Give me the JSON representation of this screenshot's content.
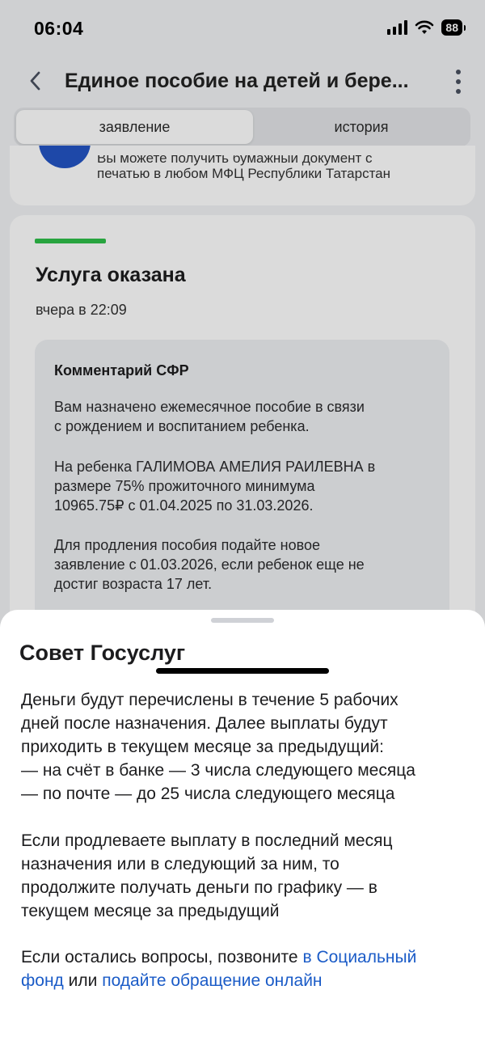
{
  "status_bar": {
    "time": "06:04",
    "battery": "88",
    "icons": [
      "signal-icon",
      "wifi-icon",
      "battery-icon"
    ]
  },
  "header": {
    "title": "Единое пособие на детей и бере...",
    "back_icon": "chevron-left-icon",
    "menu_icon": "more-vertical-icon"
  },
  "tabs": [
    {
      "label": "заявление",
      "active": true
    },
    {
      "label": "история",
      "active": false
    }
  ],
  "top_card": {
    "line1": "Вы можете получить бумажный документ с",
    "line2": "печатью в любом МФЦ Республики Татарстан"
  },
  "status_card": {
    "title": "Услуга оказана",
    "time": "вчера в 22:09",
    "progress": 1.0,
    "progress_color": "#2fbf4a",
    "comment": {
      "title": "Комментарий СФР",
      "p1": [
        "Вам назначено ежемесячное пособие в связи",
        "с рождением и воспитанием ребенка."
      ],
      "p2": [
        "На ребенка ГАЛИМОВА АМЕЛИЯ РАИЛЕВНА в",
        "размере 75% прожиточного минимума",
        "10965.75₽ с 01.04.2025 по 31.03.2026."
      ],
      "p3": [
        "Для продления пособия подайте новое",
        "заявление с 01.03.2026, если ребенок еще не",
        "достиг возраста 17 лет."
      ]
    }
  },
  "sheet": {
    "title": "Совет Госуслуг",
    "p1": [
      "Деньги будут перечислены в течение 5 рабочих",
      "дней после назначения. Далее выплаты будут",
      "приходить в текущем месяце за предыдущий:",
      "— на счёт в банке — 3 числа следующего месяца",
      "— по почте — до 25 числа следующего месяца"
    ],
    "p2": [
      "Если продлеваете выплату в последний месяц",
      "назначения или в следующий за ним, то",
      "продолжите получать деньги по графику — в",
      "текущем месяце за предыдущий"
    ],
    "p3": {
      "text1": "Если остались вопросы, позвоните ",
      "link1a": "в Социальный",
      "link1b": "фонд",
      "text2": " или ",
      "link2": "подайте обращение онлайн"
    },
    "link_color": "#1a5bc7"
  }
}
